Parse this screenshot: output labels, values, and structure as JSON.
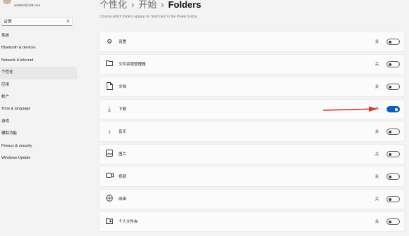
{
  "account": {
    "email": "wxkb67@163.com"
  },
  "search": {
    "placeholder": "",
    "value": "设置"
  },
  "sidebar": {
    "items": [
      {
        "label": "系统"
      },
      {
        "label": "Bluetooth & devices"
      },
      {
        "label": "Network & internet"
      },
      {
        "label": "个性化",
        "active": true
      },
      {
        "label": "应用"
      },
      {
        "label": "帐户"
      },
      {
        "label": "Time & language"
      },
      {
        "label": "游戏"
      },
      {
        "label": "辅助功能"
      },
      {
        "label": "Privacy & security"
      },
      {
        "label": "Windows Update"
      }
    ]
  },
  "header": {
    "crumb1": "个性化",
    "crumb2": "开始",
    "current": "Folders",
    "separator": "›",
    "subtitle": "Choose which folders appear on Start next to the Power button."
  },
  "folders": [
    {
      "label": "设置",
      "icon": "gear-icon",
      "state": "关",
      "on": false
    },
    {
      "label": "文件资源管理器",
      "icon": "folder-icon",
      "state": "关",
      "on": false
    },
    {
      "label": "文档",
      "icon": "document-icon",
      "state": "关",
      "on": false
    },
    {
      "label": "下载",
      "icon": "download-icon",
      "state": "开",
      "on": true
    },
    {
      "label": "音乐",
      "icon": "music-icon",
      "state": "关",
      "on": false
    },
    {
      "label": "图片",
      "icon": "picture-icon",
      "state": "关",
      "on": false
    },
    {
      "label": "视频",
      "icon": "video-icon",
      "state": "关",
      "on": false
    },
    {
      "label": "网络",
      "icon": "network-icon",
      "state": "关",
      "on": false
    },
    {
      "label": "个人文件夹",
      "icon": "personal-folder-icon",
      "state": "关",
      "on": false
    }
  ],
  "colors": {
    "accent": "#0a5fb8",
    "annotation": "#d93a2b"
  }
}
